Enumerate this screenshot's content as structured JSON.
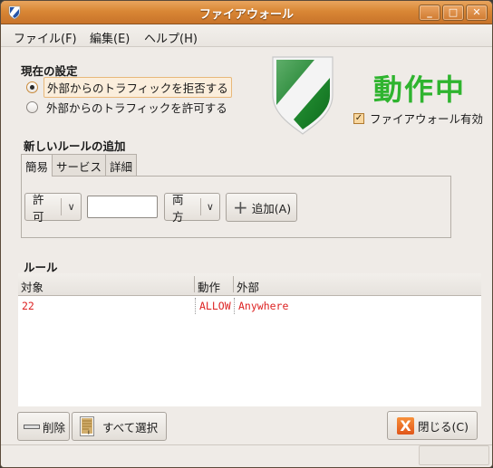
{
  "window": {
    "title": "ファイアウォール",
    "controls": {
      "minimize": "_",
      "maximize": "□",
      "close": "✕"
    }
  },
  "menubar": {
    "items": [
      {
        "label": "ファイル(F)"
      },
      {
        "label": "編集(E)"
      },
      {
        "label": "ヘルプ(H)"
      }
    ]
  },
  "current_settings": {
    "title": "現在の設定",
    "options": [
      {
        "label": "外部からのトラフィックを拒否する",
        "selected": true
      },
      {
        "label": "外部からのトラフィックを許可する",
        "selected": false
      }
    ]
  },
  "status": {
    "text": "動作中",
    "color": "#2fb42f",
    "enable_checkbox": {
      "label": "ファイアウォール有効",
      "checked": true,
      "mark": "✓"
    }
  },
  "add_rule": {
    "title": "新しいルールの追加",
    "tabs": [
      {
        "label": "簡易",
        "active": true
      },
      {
        "label": "サービス",
        "active": false
      },
      {
        "label": "詳細",
        "active": false
      }
    ],
    "action_combo": {
      "value": "許可",
      "arrow": "∨"
    },
    "port_input": {
      "value": "",
      "placeholder": ""
    },
    "direction_combo": {
      "value": "両方",
      "arrow": "∨"
    },
    "add_button": {
      "label": "追加(A)",
      "icon": "+"
    }
  },
  "rules": {
    "title": "ルール",
    "columns": [
      "対象",
      "動作",
      "外部"
    ],
    "rows": [
      {
        "target": "22",
        "action": "ALLOW",
        "from": "Anywhere"
      }
    ],
    "row_color": "#dd2222"
  },
  "buttons": {
    "delete": {
      "label": "削除"
    },
    "select_all": {
      "label": "すべて選択"
    },
    "close": {
      "label": "閉じる(C)"
    }
  }
}
